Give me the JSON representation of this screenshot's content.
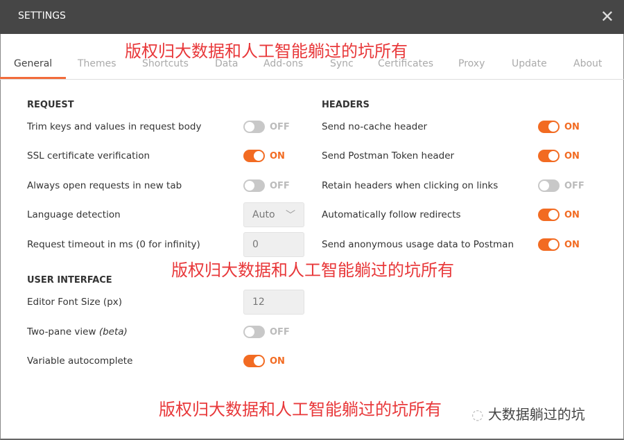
{
  "header": {
    "title": "SETTINGS",
    "close_icon": "close-icon"
  },
  "tabs": [
    "General",
    "Themes",
    "Shortcuts",
    "Data",
    "Add-ons",
    "Sync",
    "Certificates",
    "Proxy",
    "Update",
    "About"
  ],
  "active_tab": "General",
  "accent": "#f26b22",
  "request": {
    "heading": "REQUEST",
    "items": [
      {
        "label": "Trim keys and values in request body",
        "type": "toggle",
        "state": "OFF"
      },
      {
        "label": "SSL certificate verification",
        "type": "toggle",
        "state": "ON"
      },
      {
        "label": "Always open requests in new tab",
        "type": "toggle",
        "state": "OFF"
      },
      {
        "label": "Language detection",
        "type": "select",
        "value": "Auto"
      },
      {
        "label": "Request timeout in ms (0 for infinity)",
        "type": "input",
        "value": "0"
      }
    ]
  },
  "headers": {
    "heading": "HEADERS",
    "items": [
      {
        "label": "Send no-cache header",
        "state": "ON"
      },
      {
        "label": "Send Postman Token header",
        "state": "ON"
      },
      {
        "label": "Retain headers when clicking on links",
        "state": "OFF"
      },
      {
        "label": "Automatically follow redirects",
        "state": "ON"
      },
      {
        "label": "Send anonymous usage data to Postman",
        "state": "ON"
      }
    ]
  },
  "ui": {
    "heading": "USER INTERFACE",
    "items": [
      {
        "label": "Editor Font Size (px)",
        "type": "input",
        "value": "12"
      },
      {
        "label": "Two-pane view",
        "label_suffix": "(beta)",
        "type": "toggle",
        "state": "OFF"
      },
      {
        "label": "Variable autocomplete",
        "type": "toggle",
        "state": "ON"
      }
    ]
  },
  "watermarks": [
    "版权归大数据和人工智能躺过的坑所有",
    "版权归大数据和人工智能躺过的坑所有",
    "版权归大数据和人工智能躺过的坑所有"
  ],
  "brand": "大数据躺过的坑"
}
